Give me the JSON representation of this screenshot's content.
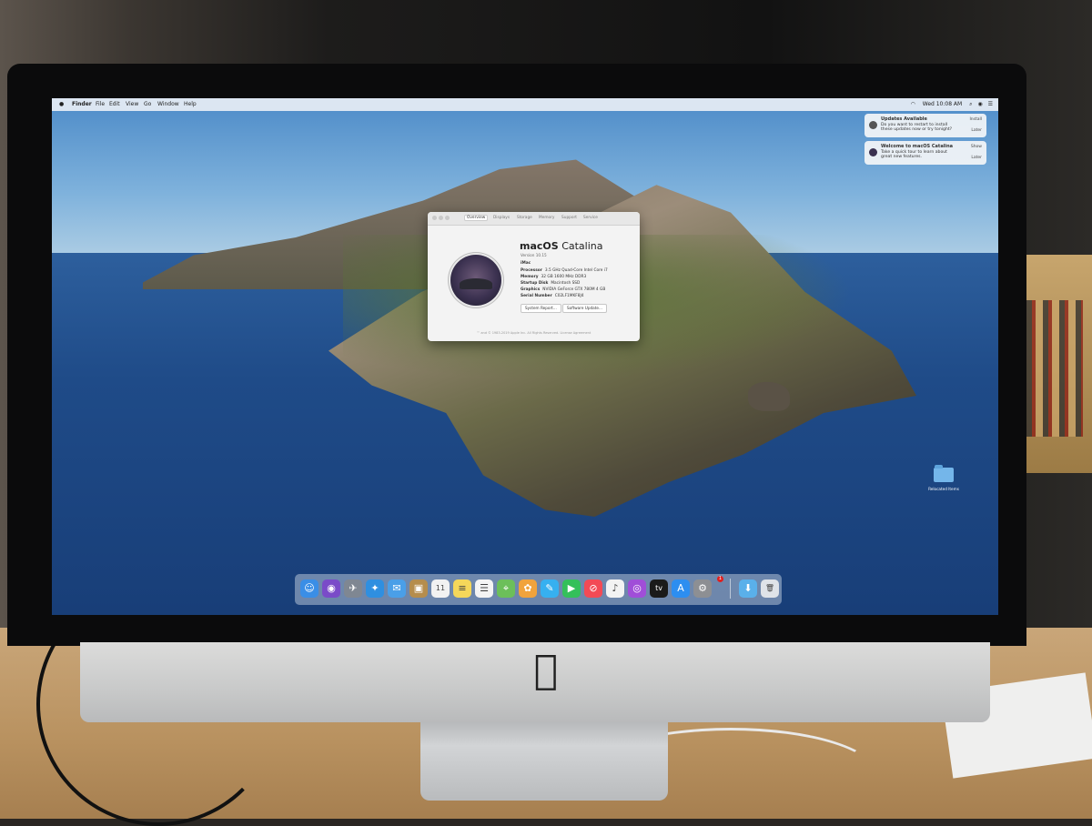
{
  "menubar": {
    "apple": "",
    "items": [
      "Finder",
      "File",
      "Edit",
      "View",
      "Go",
      "Window",
      "Help"
    ],
    "clock": "Wed 10:08 AM"
  },
  "notifications": [
    {
      "title": "Updates Available",
      "body": "Do you want to restart to install these updates now or try tonight?",
      "action_primary": "Install",
      "action_secondary": "Later"
    },
    {
      "title": "Welcome to macOS Catalina",
      "body": "Take a quick tour to learn about great new features.",
      "action_primary": "Show",
      "action_secondary": "Later"
    }
  ],
  "about_window": {
    "tabs": [
      "Overview",
      "Displays",
      "Storage",
      "Memory",
      "Support",
      "Service"
    ],
    "title_bold": "macOS",
    "title_light": "Catalina",
    "version": "Version 10.15",
    "model": "iMac",
    "specs": [
      {
        "label": "Processor",
        "value": "3.5 GHz Quad-Core Intel Core i7"
      },
      {
        "label": "Memory",
        "value": "32 GB 1600 MHz DDR3"
      },
      {
        "label": "Startup Disk",
        "value": "Macintosh SSD"
      },
      {
        "label": "Graphics",
        "value": "NVIDIA GeForce GTX 780M 4 GB"
      },
      {
        "label": "Serial Number",
        "value": "C02LF1MKF8J4"
      }
    ],
    "buttons": [
      "System Report...",
      "Software Update..."
    ],
    "footer": "™ and © 1983-2019 Apple Inc. All Rights Reserved. License Agreement"
  },
  "desktop": {
    "folder_label": "Relocated Items"
  },
  "dock": {
    "badge": "1",
    "icons": [
      {
        "name": "finder-icon",
        "glyph": "☺",
        "color": "#3a8ee6"
      },
      {
        "name": "siri-icon",
        "glyph": "◉",
        "color": "#7a4bc8"
      },
      {
        "name": "launchpad-icon",
        "glyph": "✈",
        "color": "#7f8792"
      },
      {
        "name": "safari-icon",
        "glyph": "✦",
        "color": "#2f8fe0"
      },
      {
        "name": "mail-icon",
        "glyph": "✉",
        "color": "#4a9fe8"
      },
      {
        "name": "contacts-icon",
        "glyph": "▣",
        "color": "#b58d4d"
      },
      {
        "name": "calendar-icon",
        "glyph": "11",
        "color": "#f2f2f2"
      },
      {
        "name": "notes-icon",
        "glyph": "≡",
        "color": "#f5d75a"
      },
      {
        "name": "reminders-icon",
        "glyph": "☰",
        "color": "#f4f4f4"
      },
      {
        "name": "maps-icon",
        "glyph": "⌖",
        "color": "#6cbf5a"
      },
      {
        "name": "photos-icon",
        "glyph": "✿",
        "color": "#f1a33c"
      },
      {
        "name": "messages-icon",
        "glyph": "✎",
        "color": "#36b0f0"
      },
      {
        "name": "facetime-icon",
        "glyph": "▶",
        "color": "#34c05a"
      },
      {
        "name": "news-icon",
        "glyph": "⊘",
        "color": "#f34a55"
      },
      {
        "name": "music-icon",
        "glyph": "♪",
        "color": "#f3f3f3"
      },
      {
        "name": "podcasts-icon",
        "glyph": "◎",
        "color": "#a04ed8"
      },
      {
        "name": "tv-icon",
        "glyph": "tv",
        "color": "#1a1a1a"
      },
      {
        "name": "app-store-icon",
        "glyph": "A",
        "color": "#2d8ef0"
      },
      {
        "name": "system-preferences-icon",
        "glyph": "⚙",
        "color": "#8d8f93"
      },
      {
        "name": "downloads-folder-icon",
        "glyph": "⬇",
        "color": "#5ab0ea"
      },
      {
        "name": "trash-icon",
        "glyph": "🗑",
        "color": "#dfe3e8"
      }
    ]
  }
}
